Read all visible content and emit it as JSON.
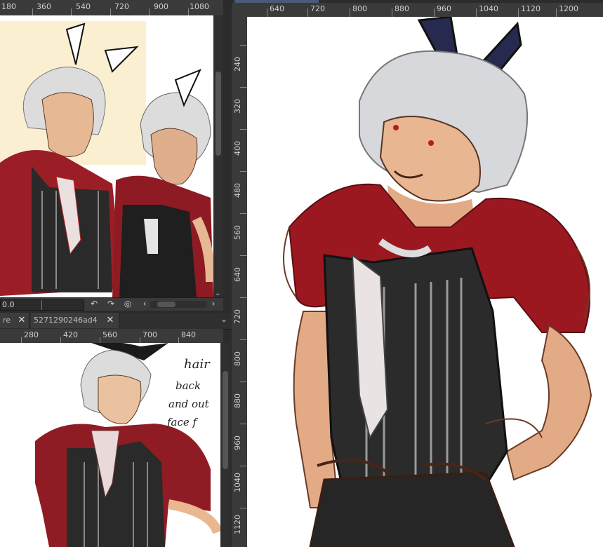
{
  "app": {
    "theme_colors": {
      "panel": "#2b2b2b",
      "ruler": "#3a3a3a",
      "canvas": "#ffffff",
      "accent": "#4a5a78"
    }
  },
  "ref_top": {
    "ruler_labels": [
      "180",
      "360",
      "540",
      "720",
      "900",
      "1080"
    ],
    "zoom_value": "0.0",
    "icons": [
      "rotate-left-icon",
      "rotate-right-icon",
      "reset-rotation-icon",
      "scroll-left-icon",
      "scroll-right-icon"
    ]
  },
  "ref_bottom": {
    "tabs": [
      {
        "label": "re",
        "close": "✕"
      },
      {
        "label": "5271290246ad4",
        "close": "✕"
      }
    ],
    "tab_menu_icon": "⌄",
    "ruler_labels": [
      "280",
      "420",
      "560",
      "700",
      "840"
    ],
    "notes": [
      "hair",
      "back",
      "and out",
      "face f"
    ]
  },
  "main": {
    "ruler_top": [
      "640",
      "720",
      "800",
      "880",
      "960",
      "1040",
      "1120",
      "1200"
    ],
    "ruler_left": [
      "240",
      "320",
      "400",
      "480",
      "560",
      "640",
      "720",
      "800",
      "880",
      "960",
      "1040",
      "1120"
    ]
  }
}
